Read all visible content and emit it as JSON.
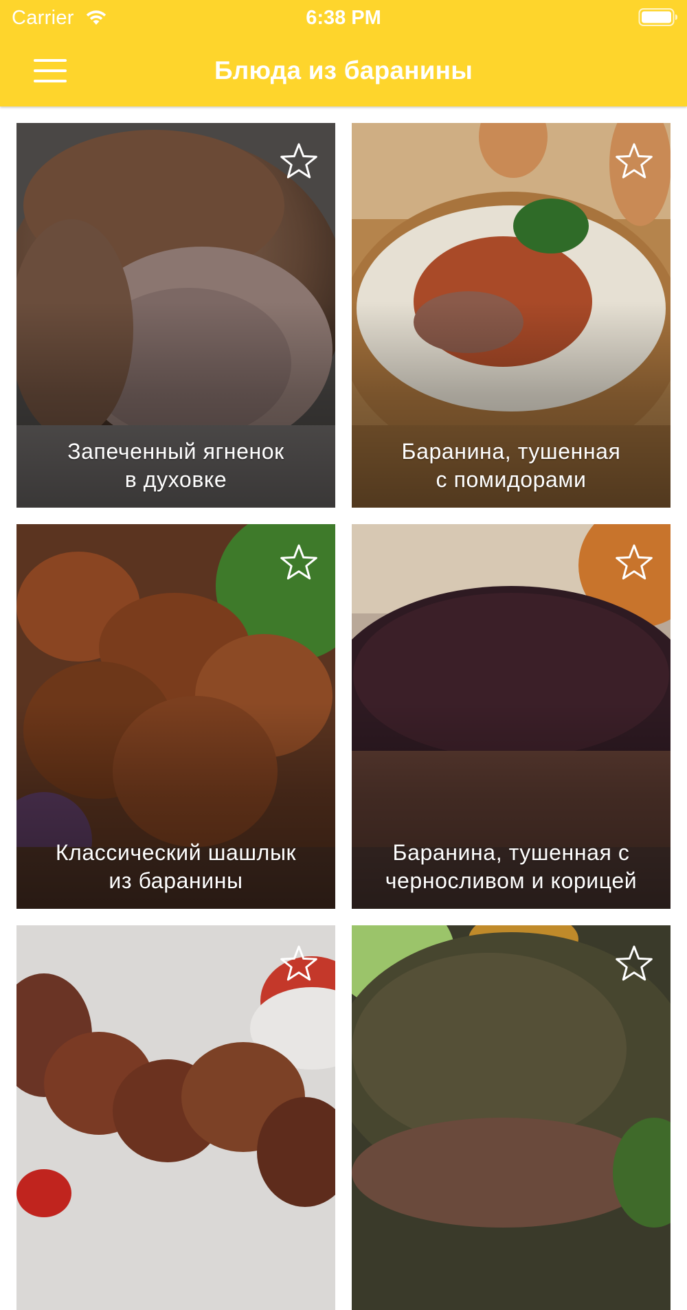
{
  "status_bar": {
    "carrier": "Carrier",
    "time": "6:38 PM"
  },
  "nav": {
    "title": "Блюда из баранины",
    "menu_icon": "hamburger-menu-icon",
    "background_color": "#fed52c"
  },
  "recipes": [
    {
      "title_line1": "Запеченный ягненок",
      "title_line2": "в духовке",
      "favorite": false,
      "icon": "star-outline-icon"
    },
    {
      "title_line1": "Баранина, тушенная",
      "title_line2": "с помидорами",
      "favorite": false,
      "icon": "star-outline-icon"
    },
    {
      "title_line1": "Классический шашлык",
      "title_line2": "из баранины",
      "favorite": false,
      "icon": "star-outline-icon"
    },
    {
      "title_line1": "Баранина, тушенная с",
      "title_line2": "черносливом и корицей",
      "favorite": false,
      "icon": "star-outline-icon"
    },
    {
      "title_line1": "",
      "title_line2": "",
      "favorite": false,
      "icon": "star-outline-icon"
    },
    {
      "title_line1": "",
      "title_line2": "",
      "favorite": false,
      "icon": "star-outline-icon"
    }
  ]
}
